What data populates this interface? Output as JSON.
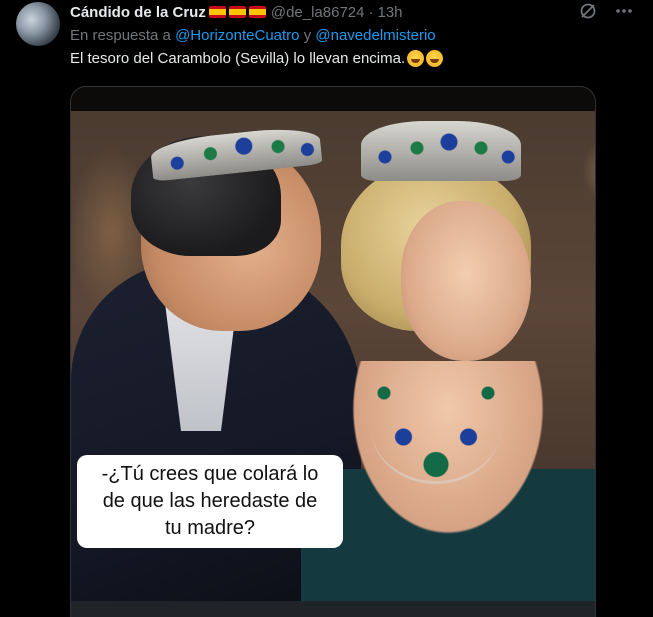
{
  "post": {
    "author_name": "Cándido de la Cruz",
    "flags": [
      "es-flag",
      "es-flag",
      "es-flag"
    ],
    "handle": "@de_la86724",
    "separator": "·",
    "timestamp": "13h",
    "reply_prefix": "En respuesta a",
    "reply_user_1": "@HorizonteCuatro",
    "reply_joiner": "y",
    "reply_user_2": "@navedelmisterio",
    "text": "El tesoro del Carambolo (Sevilla) lo llevan encima.",
    "emojis": [
      "rolling-on-floor-laughing-icon",
      "rolling-on-floor-laughing-icon"
    ]
  },
  "media": {
    "caption_lines": [
      "-¿Tú crees que colará lo",
      "de que las heredaste de",
      "tu madre?"
    ]
  },
  "colors": {
    "background": "#000000",
    "text": "#e7e9ea",
    "muted": "#71767b",
    "link": "#1d9bf0"
  }
}
